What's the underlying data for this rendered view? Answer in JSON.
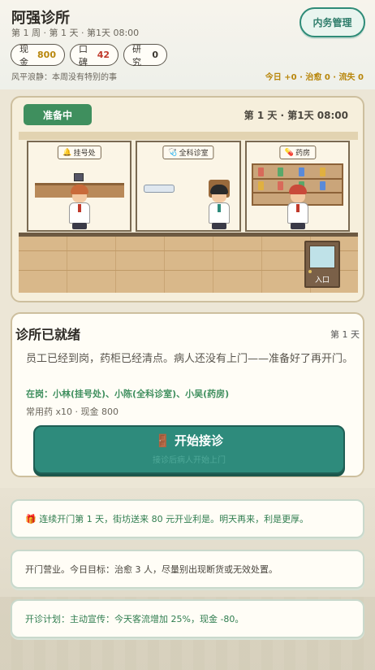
{
  "header": {
    "title": "阿强诊所",
    "subtitle": "第 1 周 · 第 1 天 · 第1天 08:00",
    "admin_button": "内务管理",
    "stats": {
      "cash_label": "现金",
      "cash_value": "800",
      "reputation_label": "口碑",
      "reputation_value": "42",
      "research_label": "研究",
      "research_value": "0"
    },
    "weather": "风平浪静：本周没有特别的事",
    "today_summary": "今日 +0 · 治愈 0 · 流失 0"
  },
  "scene": {
    "status": "准备中",
    "time": "第 1 天 · 第1天 08:00",
    "rooms": [
      {
        "label": "挂号处",
        "icon": "bell-icon"
      },
      {
        "label": "全科诊室",
        "icon": "stethoscope-icon"
      },
      {
        "label": "药房",
        "icon": "pill-icon"
      }
    ],
    "door_label": "入口"
  },
  "ready_card": {
    "title": "诊所已就绪",
    "day": "第 1 天",
    "description": "员工已经到岗，药柜已经清点。病人还没有上门——准备好了再开门。",
    "staff": "在岗：小林(挂号处)、小陈(全科诊室)、小吴(药房)",
    "meds": "常用药 x10 · 现金 800",
    "start_button": "开始接诊",
    "start_hint": "接诊后病人开始上门"
  },
  "logs": [
    "🎁 连续开门第 1 天，街坊送来 80 元开业利是。明天再来，利是更厚。",
    "开门营业。今日目标：治愈 3 人，尽量别出现断货或无效处置。",
    "开诊计划：主动宣传：今天客流增加 25%，现金 -80。"
  ],
  "colors": {
    "accent": "#2e8b7c",
    "status_green": "#3f8f5e",
    "gold": "#b8860b",
    "red": "#c0392b"
  }
}
